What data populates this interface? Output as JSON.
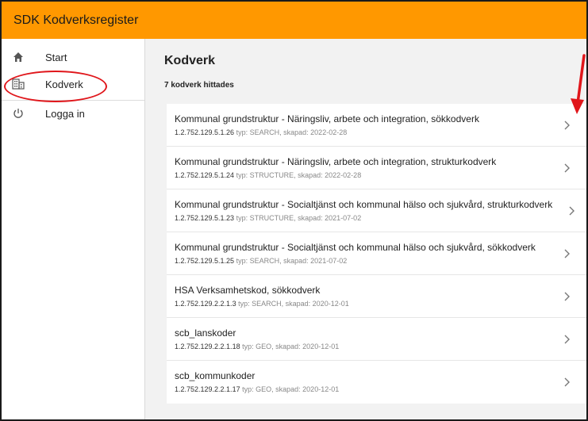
{
  "app": {
    "title": "SDK Kodverksregister"
  },
  "sidebar": {
    "items": [
      {
        "label": "Start",
        "icon": "home-icon"
      },
      {
        "label": "Kodverk",
        "icon": "building-icon"
      },
      {
        "label": "Logga in",
        "icon": "power-icon"
      }
    ]
  },
  "main": {
    "title": "Kodverk",
    "count": "7 kodverk hittades",
    "sub_prefix_type": "typ: ",
    "sub_prefix_created": "skapad: ",
    "items": [
      {
        "title": "Kommunal grundstruktur - Näringsliv, arbete och integration, sökkodverk",
        "oid": "1.2.752.129.5.1.26",
        "type": "SEARCH",
        "created": "2022-02-28"
      },
      {
        "title": "Kommunal grundstruktur - Näringsliv, arbete och integration, strukturkodverk",
        "oid": "1.2.752.129.5.1.24",
        "type": "STRUCTURE",
        "created": "2022-02-28"
      },
      {
        "title": "Kommunal grundstruktur - Socialtjänst och kommunal hälso och sjukvård, strukturkodverk",
        "oid": "1.2.752.129.5.1.23",
        "type": "STRUCTURE",
        "created": "2021-07-02"
      },
      {
        "title": "Kommunal grundstruktur - Socialtjänst och kommunal hälso och sjukvård, sökkodverk",
        "oid": "1.2.752.129.5.1.25",
        "type": "SEARCH",
        "created": "2021-07-02"
      },
      {
        "title": "HSA Verksamhetskod, sökkodverk",
        "oid": "1.2.752.129.2.2.1.3",
        "type": "SEARCH",
        "created": "2020-12-01"
      },
      {
        "title": "scb_lanskoder",
        "oid": "1.2.752.129.2.2.1.18",
        "type": "GEO",
        "created": "2020-12-01"
      },
      {
        "title": "scb_kommunkoder",
        "oid": "1.2.752.129.2.2.1.17",
        "type": "GEO",
        "created": "2020-12-01"
      }
    ]
  },
  "colors": {
    "appbar": "#ff9800",
    "annotation": "#e0161b",
    "background": "#f2f2f2"
  }
}
